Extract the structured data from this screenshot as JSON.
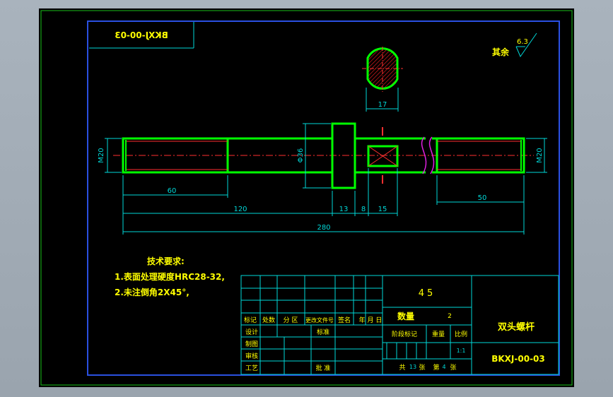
{
  "drawing": {
    "mirrored_code": "BKXJ-00-03",
    "surface_finish": {
      "label": "其余",
      "value": "6.3"
    },
    "dimensions": {
      "section_width": "17",
      "thread_left": "M20",
      "thread_right": "M20",
      "collar_dia": "Φ36",
      "d60": "60",
      "d50": "50",
      "d120": "120",
      "d13": "13",
      "d8": "8",
      "d15": "15",
      "d280": "280"
    },
    "tech_req": {
      "title": "技术要求:",
      "line1": "1.表面处理硬度HRC28-32,",
      "line2": "2.未注倒角2X45°,"
    },
    "title_block": {
      "material": "45",
      "part_name": "双头螺杆",
      "part_code": "BKXJ-00-03",
      "h_mark": "标记",
      "h_count": "处数",
      "h_zone": "分 区",
      "h_docno": "更改文件号",
      "h_sign": "签名",
      "h_date": "年 月 日",
      "design": "设计",
      "standard": "标准",
      "draw": "制图",
      "review": "审核",
      "process": "工艺",
      "approve": "批 准",
      "qty_label": "数量",
      "qty_value": "2",
      "stage_mark": "阶段标记",
      "weight": "重量",
      "scale": "比例",
      "scale_value": "1:1",
      "total_label": "共",
      "total_sheets": "13",
      "sheet_unit": "张",
      "sheet_label": "第",
      "sheet_no": "4",
      "sheet_unit2": "张"
    }
  },
  "colors": {
    "background": "#000000",
    "outer_frame": "#18c018",
    "border": "#2a50e0",
    "part_outline": "#00ff00",
    "dimension": "#00d8d8",
    "text": "#ffff00",
    "centerline": "#ff3030",
    "hatch": "#ff2020",
    "break_line": "#e020e0"
  }
}
